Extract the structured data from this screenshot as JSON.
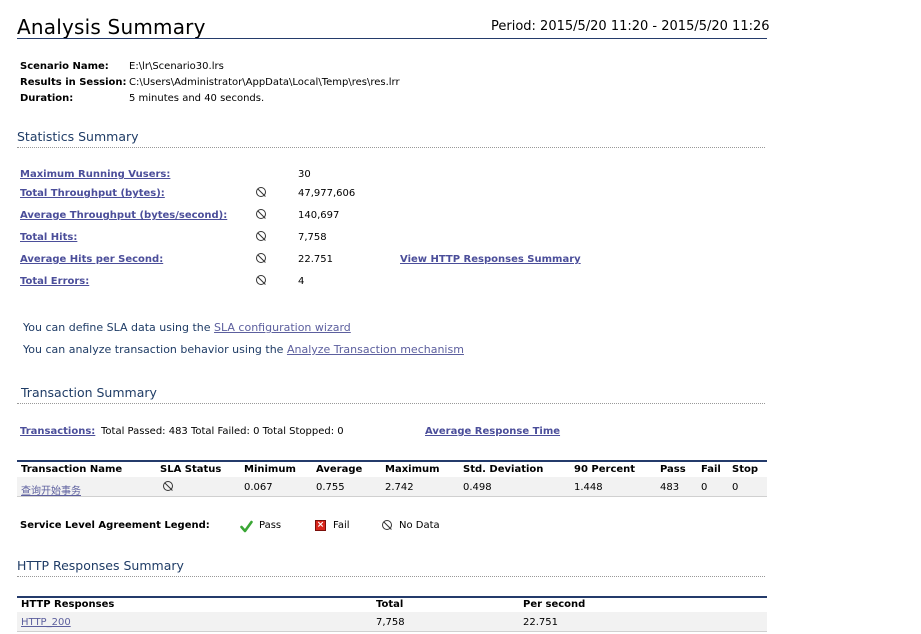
{
  "header": {
    "title": "Analysis Summary",
    "period": "Period: 2015/5/20 11:20 - 2015/5/20 11:26"
  },
  "info": {
    "scenario_label": "Scenario Name:",
    "scenario_value": "E:\\lr\\Scenario30.lrs",
    "results_label": "Results in Session:",
    "results_value": "C:\\Users\\Administrator\\AppData\\Local\\Temp\\res\\res.lrr",
    "duration_label": "Duration:",
    "duration_value": "5 minutes and 40 seconds."
  },
  "statistics": {
    "heading": "Statistics Summary",
    "rows": [
      {
        "label": "Maximum Running Vusers:",
        "value": "30",
        "icon": "none"
      },
      {
        "label": "Total Throughput (bytes):",
        "value": "47,977,606",
        "icon": "no-data-icon"
      },
      {
        "label": "Average Throughput (bytes/second):",
        "value": "140,697",
        "icon": "no-data-icon"
      },
      {
        "label": "Total Hits:",
        "value": "7,758",
        "icon": "no-data-icon"
      },
      {
        "label": "Average Hits per Second:",
        "value": "22.751",
        "icon": "no-data-icon"
      },
      {
        "label": "Total Errors:",
        "value": "4",
        "icon": "no-data-icon"
      }
    ],
    "http_link": "View HTTP Responses Summary"
  },
  "sla": {
    "line1_prefix": "You can define SLA data using the ",
    "line1_link": "SLA configuration wizard",
    "line2_prefix": "You can analyze transaction behavior using the ",
    "line2_link": "Analyze Transaction mechanism"
  },
  "transactions": {
    "heading": "Transaction Summary",
    "link": "Transactions:",
    "totals": "Total Passed: 483 Total Failed: 0 Total Stopped: 0",
    "avg_link": "Average Response Time",
    "columns": [
      "Transaction Name",
      "SLA Status",
      "Minimum",
      "Average",
      "Maximum",
      "Std. Deviation",
      "90 Percent",
      "Pass",
      "Fail",
      "Stop"
    ],
    "rows": [
      {
        "name": "查询开始事务",
        "minimum": "0.067",
        "average": "0.755",
        "maximum": "2.742",
        "std": "0.498",
        "p90": "1.448",
        "pass": "483",
        "fail": "0",
        "stop": "0"
      }
    ]
  },
  "legend": {
    "label": "Service Level Agreement Legend:",
    "pass": "Pass",
    "fail": "Fail",
    "nodata": "No Data"
  },
  "http": {
    "heading": "HTTP Responses Summary",
    "columns": [
      "HTTP Responses",
      "Total",
      "Per second"
    ],
    "rows": [
      {
        "name": "HTTP_200",
        "total": "7,758",
        "per_second": "22.751"
      }
    ]
  },
  "colors": {
    "heading": "#1f3c66",
    "link": "#4b4e9a",
    "rule": "#243b6b",
    "pass": "#3aa635",
    "fail": "#d9261c"
  }
}
